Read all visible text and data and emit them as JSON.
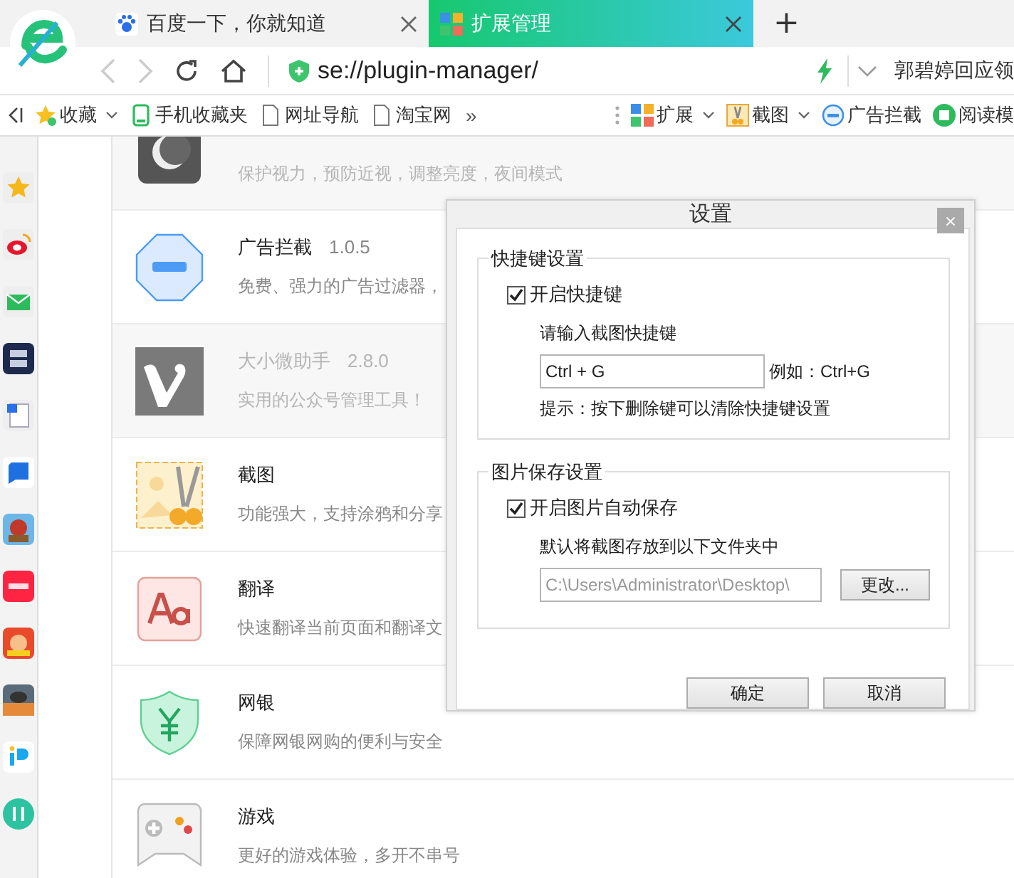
{
  "tabs": [
    {
      "label": "百度一下，你就知道",
      "selected": false
    },
    {
      "label": "扩展管理",
      "selected": true
    }
  ],
  "new_tab": "+",
  "address": {
    "url": "se://plugin-manager/"
  },
  "news_ticker": "郭碧婷回应领",
  "bookmarks": [
    {
      "label": "收藏",
      "dropdown": true
    },
    {
      "label": "手机收藏夹",
      "dropdown": false
    },
    {
      "label": "网址导航",
      "dropdown": false
    },
    {
      "label": "淘宝网",
      "dropdown": false
    }
  ],
  "bookmarks_more": "»",
  "tools": [
    {
      "label": "扩展",
      "dropdown": true
    },
    {
      "label": "截图",
      "dropdown": true
    },
    {
      "label": "广告拦截",
      "dropdown": false
    },
    {
      "label": "阅读模",
      "dropdown": false
    }
  ],
  "plugins": [
    {
      "description": "保护视力，预防近视，调整亮度，夜间模式",
      "disabled": true
    },
    {
      "name": "广告拦截",
      "version": "1.0.5",
      "description": "免费、强力的广告过滤器，",
      "disabled": false
    },
    {
      "name": "大小微助手",
      "version": "2.8.0",
      "description": "实用的公众号管理工具！",
      "disabled": true
    },
    {
      "name": "截图",
      "description": "功能强大，支持涂鸦和分享",
      "disabled": false
    },
    {
      "name": "翻译",
      "description": "快速翻译当前页面和翻译文",
      "disabled": false
    },
    {
      "name": "网银",
      "description": "保障网银网购的便利与安全",
      "disabled": false
    },
    {
      "name": "游戏",
      "description": "更好的游戏体验，多开不串号",
      "disabled": false
    }
  ],
  "dialog": {
    "title": "设置",
    "close": "×",
    "shortcut_group": {
      "title": "快捷键设置",
      "enable": {
        "label": "开启快捷键",
        "checked": true
      },
      "prompt": "请输入截图快捷键",
      "value": "Ctrl + G",
      "example": "例如：Ctrl+G",
      "hint": "提示：按下删除键可以清除快捷键设置"
    },
    "save_group": {
      "title": "图片保存设置",
      "enable": {
        "label": "开启图片自动保存",
        "checked": true
      },
      "prompt": "默认将截图存放到以下文件夹中",
      "path": "C:\\Users\\Administrator\\Desktop\\",
      "browse": "更改..."
    },
    "buttons": [
      "确定",
      "取消"
    ]
  }
}
